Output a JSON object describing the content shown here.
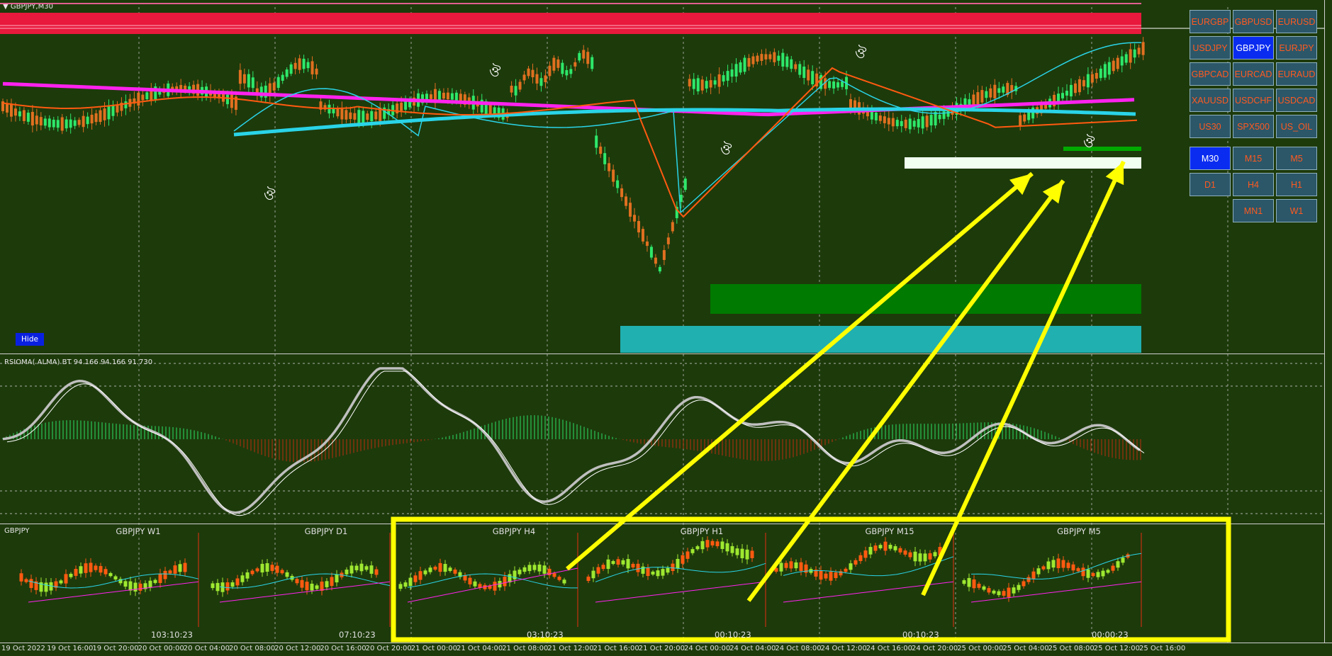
{
  "chart_title": "GBPJPY,M30",
  "hide_label": "Hide",
  "indicator_title": "RSIOMA( ALMA) BT 94.166 94.166 91.730",
  "mini_panel_title": "GBPJPY",
  "mini_charts": [
    {
      "title": "GBPJPY W1",
      "timer": "103:10:23"
    },
    {
      "title": "GBPJPY D1",
      "timer": "07:10:23"
    },
    {
      "title": "GBPJPY H4",
      "timer": "03:10:23"
    },
    {
      "title": "GBPJPY H1",
      "timer": "00:10:23"
    },
    {
      "title": "GBPJPY M15",
      "timer": "00:10:23"
    },
    {
      "title": "GBPJPY M5",
      "timer": "00:00:23"
    }
  ],
  "symbol_buttons": [
    "EURGBP",
    "GBPUSD",
    "EURUSD",
    "USDJPY",
    "GBPJPY",
    "EURJPY",
    "GBPCAD",
    "EURCAD",
    "EURAUD",
    "XAUUSD",
    "USDCHF",
    "USDCAD",
    "US30",
    "SPX500",
    "US_OIL"
  ],
  "active_symbol": "GBPJPY",
  "timeframe_buttons": [
    "M30",
    "M15",
    "M5",
    "D1",
    "H4",
    "H1",
    "MN1",
    "W1"
  ],
  "active_timeframe": "M30",
  "time_axis": [
    "19 Oct 2022",
    "19 Oct 16:00",
    "19 Oct 20:00",
    "20 Oct 00:00",
    "20 Oct 04:00",
    "20 Oct 08:00",
    "20 Oct 12:00",
    "20 Oct 16:00",
    "20 Oct 20:00",
    "21 Oct 00:00",
    "21 Oct 04:00",
    "21 Oct 08:00",
    "21 Oct 12:00",
    "21 Oct 16:00",
    "21 Oct 20:00",
    "24 Oct 00:00",
    "24 Oct 04:00",
    "24 Oct 08:00",
    "24 Oct 12:00",
    "24 Oct 16:00",
    "24 Oct 20:00",
    "25 Oct 00:00",
    "25 Oct 04:00",
    "25 Oct 08:00",
    "25 Oct 12:00",
    "25 Oct 16:00"
  ],
  "fractal_glyph": "ঔ",
  "colors": {
    "background": "#1d3a0b",
    "bull": "#2ee86a",
    "bear": "#e07020",
    "ma_orange": "#ff5a10",
    "ma_cyan": "#2ad4e8",
    "ma_magenta": "#ff22ee",
    "resistance_zone": "#e8193c",
    "highlight": "#ffff00"
  }
}
